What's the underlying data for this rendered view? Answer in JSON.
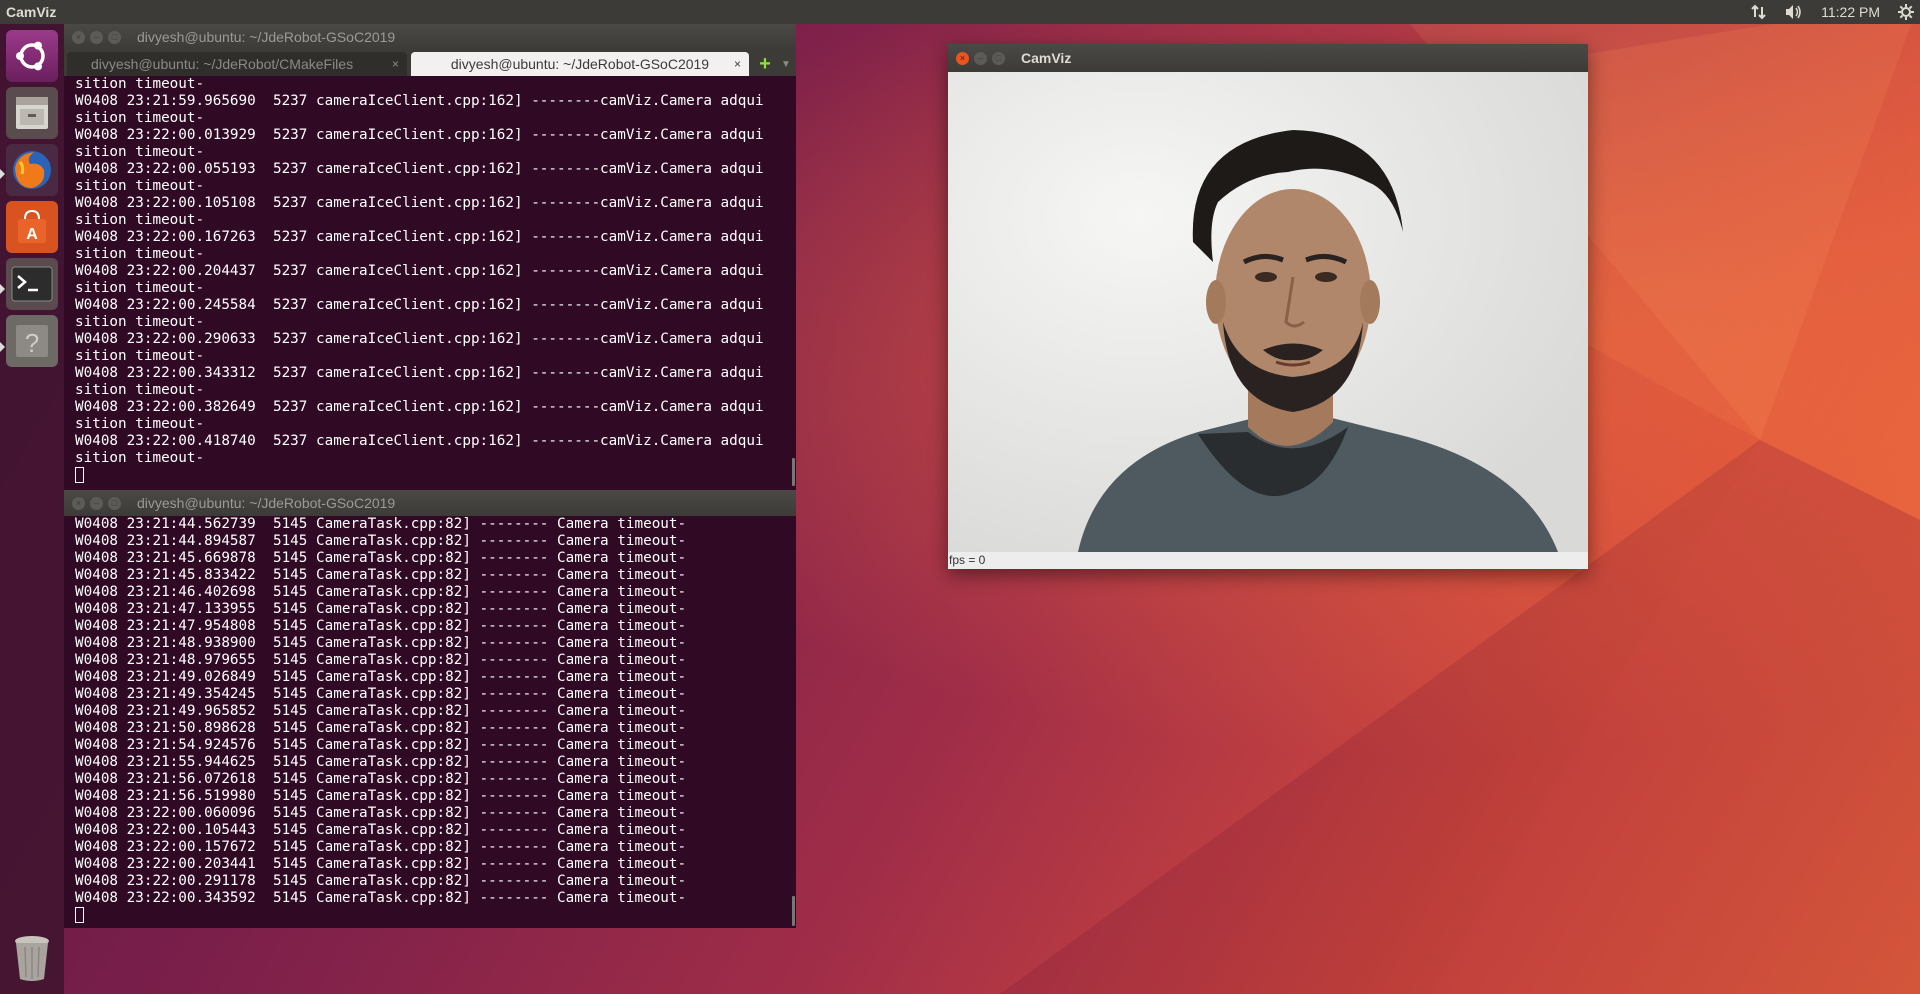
{
  "top_panel": {
    "app_title": "CamViz",
    "clock": "11:22 PM",
    "icons": [
      "network-transfer-icon",
      "volume-icon",
      "settings-gear-icon"
    ]
  },
  "launcher": {
    "items": [
      "ubuntu-dash",
      "files",
      "firefox",
      "software-center",
      "terminal",
      "help"
    ],
    "trash": "trash"
  },
  "terminal_top": {
    "title": "divyesh@ubuntu: ~/JdeRobot-GSoC2019",
    "tabs": [
      {
        "label": "divyesh@ubuntu: ~/JdeRobot/CMakeFiles",
        "active": false,
        "close": "×"
      },
      {
        "label": "divyesh@ubuntu: ~/JdeRobot-GSoC2019",
        "active": true,
        "close": "×"
      }
    ],
    "add_tab": "+",
    "lines": [
      "sition timeout-",
      "W0408 23:21:59.965690  5237 cameraIceClient.cpp:162] --------camViz.Camera adqui",
      "sition timeout-",
      "W0408 23:22:00.013929  5237 cameraIceClient.cpp:162] --------camViz.Camera adqui",
      "sition timeout-",
      "W0408 23:22:00.055193  5237 cameraIceClient.cpp:162] --------camViz.Camera adqui",
      "sition timeout-",
      "W0408 23:22:00.105108  5237 cameraIceClient.cpp:162] --------camViz.Camera adqui",
      "sition timeout-",
      "W0408 23:22:00.167263  5237 cameraIceClient.cpp:162] --------camViz.Camera adqui",
      "sition timeout-",
      "W0408 23:22:00.204437  5237 cameraIceClient.cpp:162] --------camViz.Camera adqui",
      "sition timeout-",
      "W0408 23:22:00.245584  5237 cameraIceClient.cpp:162] --------camViz.Camera adqui",
      "sition timeout-",
      "W0408 23:22:00.290633  5237 cameraIceClient.cpp:162] --------camViz.Camera adqui",
      "sition timeout-",
      "W0408 23:22:00.343312  5237 cameraIceClient.cpp:162] --------camViz.Camera adqui",
      "sition timeout-",
      "W0408 23:22:00.382649  5237 cameraIceClient.cpp:162] --------camViz.Camera adqui",
      "sition timeout-",
      "W0408 23:22:00.418740  5237 cameraIceClient.cpp:162] --------camViz.Camera adqui",
      "sition timeout-"
    ]
  },
  "terminal_bottom": {
    "title": "divyesh@ubuntu: ~/JdeRobot-GSoC2019",
    "lines": [
      "W0408 23:21:44.562739  5145 CameraTask.cpp:82] -------- Camera timeout-",
      "W0408 23:21:44.894587  5145 CameraTask.cpp:82] -------- Camera timeout-",
      "W0408 23:21:45.669878  5145 CameraTask.cpp:82] -------- Camera timeout-",
      "W0408 23:21:45.833422  5145 CameraTask.cpp:82] -------- Camera timeout-",
      "W0408 23:21:46.402698  5145 CameraTask.cpp:82] -------- Camera timeout-",
      "W0408 23:21:47.133955  5145 CameraTask.cpp:82] -------- Camera timeout-",
      "W0408 23:21:47.954808  5145 CameraTask.cpp:82] -------- Camera timeout-",
      "W0408 23:21:48.938900  5145 CameraTask.cpp:82] -------- Camera timeout-",
      "W0408 23:21:48.979655  5145 CameraTask.cpp:82] -------- Camera timeout-",
      "W0408 23:21:49.026849  5145 CameraTask.cpp:82] -------- Camera timeout-",
      "W0408 23:21:49.354245  5145 CameraTask.cpp:82] -------- Camera timeout-",
      "W0408 23:21:49.965852  5145 CameraTask.cpp:82] -------- Camera timeout-",
      "W0408 23:21:50.898628  5145 CameraTask.cpp:82] -------- Camera timeout-",
      "W0408 23:21:54.924576  5145 CameraTask.cpp:82] -------- Camera timeout-",
      "W0408 23:21:55.944625  5145 CameraTask.cpp:82] -------- Camera timeout-",
      "W0408 23:21:56.072618  5145 CameraTask.cpp:82] -------- Camera timeout-",
      "W0408 23:21:56.519980  5145 CameraTask.cpp:82] -------- Camera timeout-",
      "W0408 23:22:00.060096  5145 CameraTask.cpp:82] -------- Camera timeout-",
      "W0408 23:22:00.105443  5145 CameraTask.cpp:82] -------- Camera timeout-",
      "W0408 23:22:00.157672  5145 CameraTask.cpp:82] -------- Camera timeout-",
      "W0408 23:22:00.203441  5145 CameraTask.cpp:82] -------- Camera timeout-",
      "W0408 23:22:00.291178  5145 CameraTask.cpp:82] -------- Camera timeout-",
      "W0408 23:22:00.343592  5145 CameraTask.cpp:82] -------- Camera timeout-"
    ]
  },
  "camviz_window": {
    "title": "CamViz",
    "fps_label": "fps = 0"
  },
  "colors": {
    "terminal_bg": "#300a24",
    "panel_bg": "#3c3b37",
    "close_button": "#e95420",
    "tab_add": "#8ae234"
  }
}
